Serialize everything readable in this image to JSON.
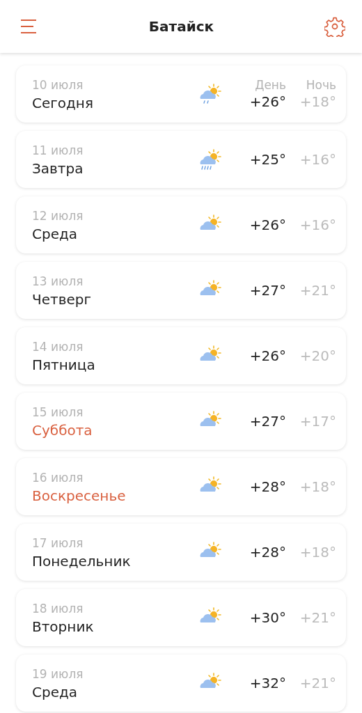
{
  "header": {
    "title": "Батайск"
  },
  "columns": {
    "day": "День",
    "night": "Ночь"
  },
  "days": [
    {
      "date": "10 июля",
      "name": "Сегодня",
      "weekend": false,
      "kind": "drizzle",
      "day": "+26°",
      "night": "+18°"
    },
    {
      "date": "11 июля",
      "name": "Завтра",
      "weekend": false,
      "kind": "rain",
      "day": "+25°",
      "night": "+16°"
    },
    {
      "date": "12 июля",
      "name": "Среда",
      "weekend": false,
      "kind": "cloudy",
      "day": "+26°",
      "night": "+16°"
    },
    {
      "date": "13 июля",
      "name": "Четверг",
      "weekend": false,
      "kind": "cloudy",
      "day": "+27°",
      "night": "+21°"
    },
    {
      "date": "14 июля",
      "name": "Пятница",
      "weekend": false,
      "kind": "cloudy",
      "day": "+26°",
      "night": "+20°"
    },
    {
      "date": "15 июля",
      "name": "Суббота",
      "weekend": true,
      "kind": "cloudy",
      "day": "+27°",
      "night": "+17°"
    },
    {
      "date": "16 июля",
      "name": "Воскресенье",
      "weekend": true,
      "kind": "cloudy",
      "day": "+28°",
      "night": "+18°"
    },
    {
      "date": "17 июля",
      "name": "Понедельник",
      "weekend": false,
      "kind": "cloudy",
      "day": "+28°",
      "night": "+18°"
    },
    {
      "date": "18 июля",
      "name": "Вторник",
      "weekend": false,
      "kind": "cloudy",
      "day": "+30°",
      "night": "+21°"
    },
    {
      "date": "19 июля",
      "name": "Среда",
      "weekend": false,
      "kind": "cloudy",
      "day": "+32°",
      "night": "+21°"
    }
  ]
}
